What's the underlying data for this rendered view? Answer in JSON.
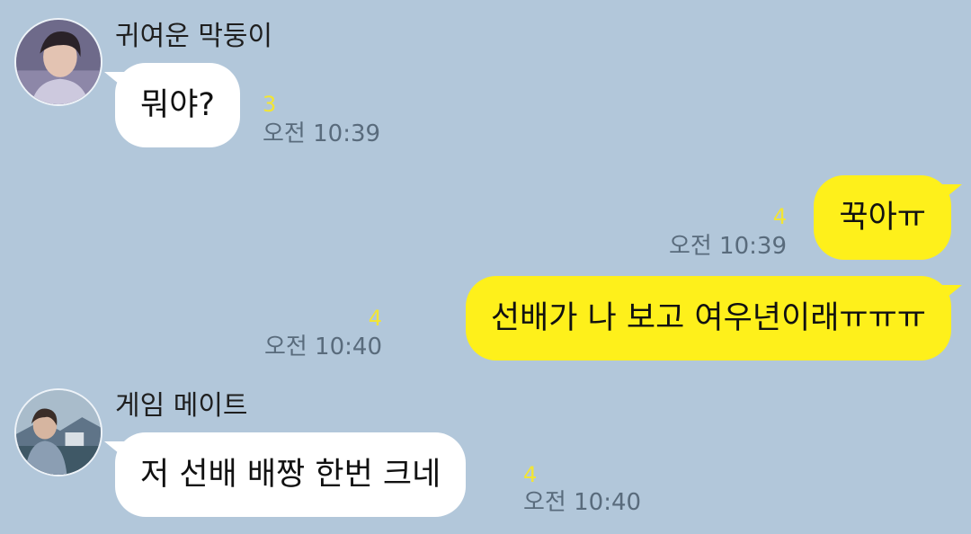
{
  "colors": {
    "background": "#b2c7da",
    "incoming_bubble": "#ffffff",
    "outgoing_bubble": "#fef01b",
    "unread_count": "#f2e534",
    "timestamp": "#596b7c"
  },
  "messages": [
    {
      "direction": "incoming",
      "sender": "귀여운 막둥이",
      "avatar_icon": "profile-photo-icon",
      "text": "뭐야?",
      "unread": "3",
      "time": "오전 10:39"
    },
    {
      "direction": "outgoing",
      "text": "꾹아ㅠ",
      "unread": "4",
      "time": "오전 10:39"
    },
    {
      "direction": "outgoing",
      "text": "선배가 나 보고 여우년이래ㅠㅠㅠ",
      "unread": "4",
      "time": "오전 10:40"
    },
    {
      "direction": "incoming",
      "sender": "게임 메이트",
      "avatar_icon": "profile-photo-icon",
      "text": "저 선배 배짱 한번 크네",
      "unread": "4",
      "time": "오전 10:40"
    }
  ]
}
